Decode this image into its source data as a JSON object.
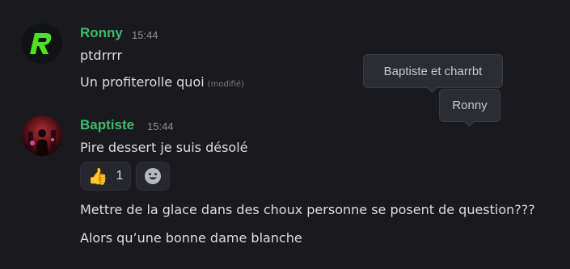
{
  "colors": {
    "background": "#1a1a1e",
    "author_name": "#3dba6f",
    "timestamp": "#8e9097",
    "message_text": "#dcdde1",
    "reaction_bg": "#26272c",
    "tooltip_bg": "#2b2d33",
    "ronny_logo": "#4fe022"
  },
  "messages": [
    {
      "author": "Ronny",
      "time": "15:44",
      "avatar_icon": "green-r-logo",
      "lines": [
        "ptdrrrr",
        "Un profiterolle quoi"
      ],
      "edited_label": "(modifié)"
    },
    {
      "author": "Baptiste",
      "time": "15:44",
      "avatar_icon": "dark-red-photo",
      "lines": [
        "Pire dessert je suis désolé"
      ],
      "reactions": [
        {
          "emoji": "👍",
          "count": "1"
        }
      ],
      "add_reaction_icon": "smiley-face-icon"
    },
    {
      "lines": [
        "Mettre de la glace dans des choux personne se posent de question???",
        "Alors qu’une bonne dame blanche"
      ]
    }
  ],
  "tooltips": [
    {
      "text": "Baptiste et charrbt"
    },
    {
      "text": "Ronny"
    }
  ]
}
